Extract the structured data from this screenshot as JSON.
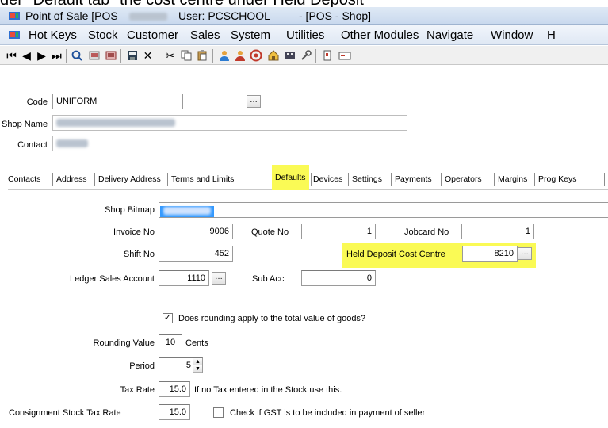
{
  "caption": {
    "text": "der \"Default tab\" the cost centre under Held Deposit"
  },
  "title_bar": {
    "app_name": "Point of Sale [POS",
    "user_label": "User: PCSCHOOL",
    "module": "- [POS - Shop]"
  },
  "menu": {
    "items": [
      "Hot Keys",
      "Stock",
      "Customer",
      "Sales",
      "System",
      "Utilities",
      "Other Modules",
      "Navigate",
      "Window",
      "H"
    ]
  },
  "toolbar": {
    "icons": [
      "first-record",
      "prev-record",
      "next-record",
      "last-record",
      "search",
      "find-previous",
      "find-next",
      "save",
      "delete",
      "cut",
      "copy",
      "paste",
      "user-add",
      "user-edit",
      "help",
      "home",
      "view",
      "tools",
      "exit",
      "keyboard"
    ]
  },
  "header_form": {
    "code_label": "Code",
    "code_value": "UNIFORM",
    "shop_name_label": "Shop Name",
    "contact_label": "Contact"
  },
  "tabs": {
    "items": [
      "Contacts",
      "Address",
      "Delivery Address",
      "Terms and Limits",
      "Defaults",
      "Devices",
      "Settings",
      "Payments",
      "Operators",
      "Margins",
      "Prog Keys"
    ],
    "active": "Defaults"
  },
  "defaults": {
    "shop_bitmap_label": "Shop Bitmap",
    "invoice_no_label": "Invoice No",
    "invoice_no_value": "9006",
    "quote_no_label": "Quote No",
    "quote_no_value": "1",
    "jobcard_no_label": "Jobcard No",
    "jobcard_no_value": "1",
    "shift_no_label": "Shift No",
    "shift_no_value": "452",
    "held_deposit_label": "Held Deposit Cost Centre",
    "held_deposit_value": "8210",
    "ledger_sales_label": "Ledger Sales Account",
    "ledger_sales_value": "1110",
    "sub_acc_label": "Sub Acc",
    "sub_acc_value": "0",
    "rounding_checkbox_label": "Does rounding apply to the total value of goods?",
    "rounding_checked": true,
    "rounding_value_label": "Rounding Value",
    "rounding_value": "10",
    "rounding_unit": "Cents",
    "period_label": "Period",
    "period_value": "5",
    "tax_rate_label": "Tax Rate",
    "tax_rate_value": "15.0",
    "tax_rate_note": "If no Tax entered in the Stock use this.",
    "consignment_tax_label": "Consignment Stock Tax Rate",
    "consignment_tax_value": "15.0",
    "gst_checkbox_label": "Check if GST is to be included in payment of seller",
    "gst_checked": false
  },
  "colors": {
    "highlight": "#fafa55",
    "selection": "#3399ff",
    "title_gradient": "#c9d9ee"
  }
}
